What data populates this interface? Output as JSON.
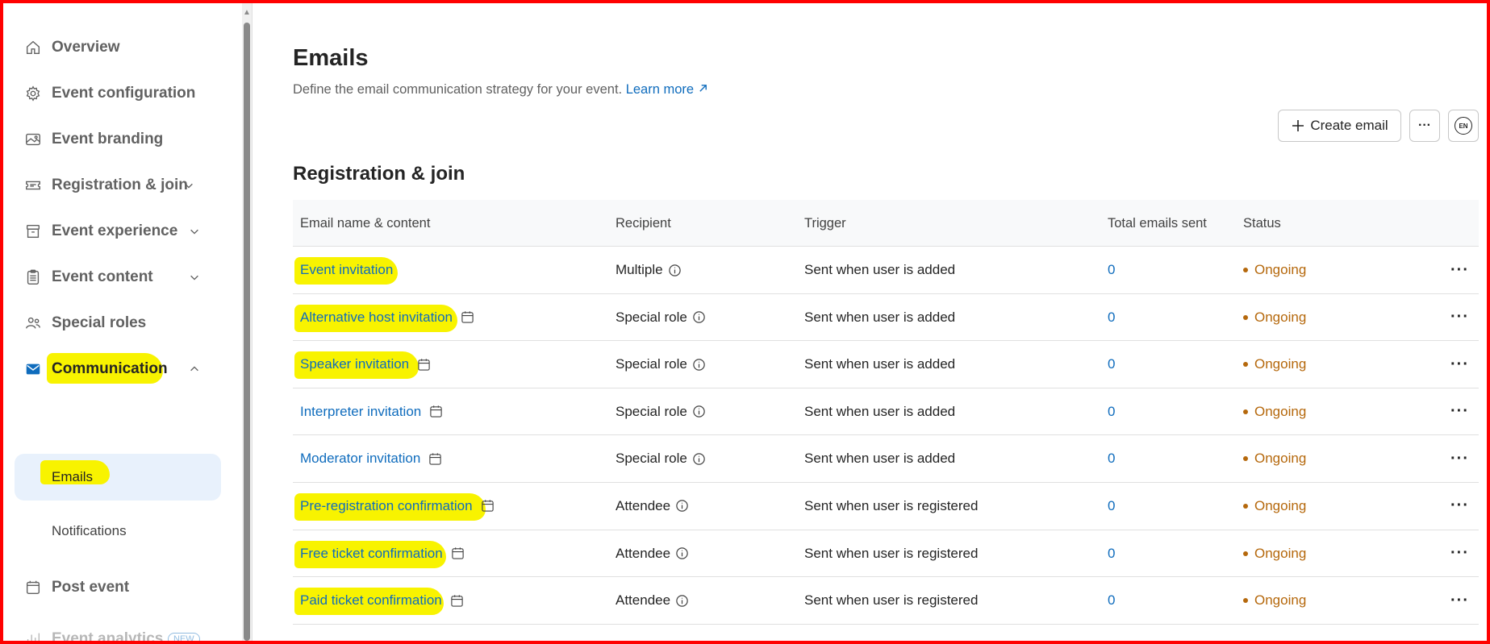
{
  "sidebar": {
    "items": [
      {
        "label": "Overview",
        "icon": "home-icon"
      },
      {
        "label": "Event configuration",
        "icon": "gear-icon"
      },
      {
        "label": "Event branding",
        "icon": "image-icon"
      },
      {
        "label": "Registration & join",
        "icon": "ticket-icon"
      },
      {
        "label": "Event experience",
        "icon": "layout-icon"
      },
      {
        "label": "Event content",
        "icon": "clipboard-icon"
      },
      {
        "label": "Special roles",
        "icon": "people-icon"
      },
      {
        "label": "Communication",
        "icon": "mail-icon"
      },
      {
        "label": "Post event",
        "icon": "calendar-icon"
      },
      {
        "label": "Event analytics",
        "icon": "chart-icon",
        "badge": "NEW"
      }
    ],
    "sub_items": [
      {
        "label": "Emails"
      },
      {
        "label": "Notifications"
      }
    ]
  },
  "header": {
    "title": "Emails",
    "description": "Define the email communication strategy for your event.",
    "learn_more": "Learn more"
  },
  "toolbar": {
    "create_label": "Create email",
    "more_label": "···",
    "lang_label": "EN"
  },
  "section": {
    "title": "Registration & join"
  },
  "table": {
    "columns": [
      "Email name & content",
      "Recipient",
      "Trigger",
      "Total emails sent",
      "Status"
    ],
    "rows": [
      {
        "name": "Event invitation",
        "recipient": "Multiple",
        "trigger": "Sent when user is added",
        "total": "0",
        "status": "Ongoing"
      },
      {
        "name": "Alternative host invitation",
        "recipient": "Special role",
        "trigger": "Sent when user is added",
        "total": "0",
        "status": "Ongoing"
      },
      {
        "name": "Speaker invitation",
        "recipient": "Special role",
        "trigger": "Sent when user is added",
        "total": "0",
        "status": "Ongoing"
      },
      {
        "name": "Interpreter invitation",
        "recipient": "Special role",
        "trigger": "Sent when user is added",
        "total": "0",
        "status": "Ongoing"
      },
      {
        "name": "Moderator invitation",
        "recipient": "Special role",
        "trigger": "Sent when user is added",
        "total": "0",
        "status": "Ongoing"
      },
      {
        "name": "Pre-registration confirmation",
        "recipient": "Attendee",
        "trigger": "Sent when user is registered",
        "total": "0",
        "status": "Ongoing"
      },
      {
        "name": "Free ticket confirmation",
        "recipient": "Attendee",
        "trigger": "Sent when user is registered",
        "total": "0",
        "status": "Ongoing"
      },
      {
        "name": "Paid ticket confirmation",
        "recipient": "Attendee",
        "trigger": "Sent when user is registered",
        "total": "0",
        "status": "Ongoing"
      }
    ],
    "row_more_label": "···"
  },
  "colors": {
    "accent": "#0f6cbd",
    "status_ongoing": "#b5680c",
    "highlight": "#f8f300",
    "frame": "#ff0000"
  }
}
